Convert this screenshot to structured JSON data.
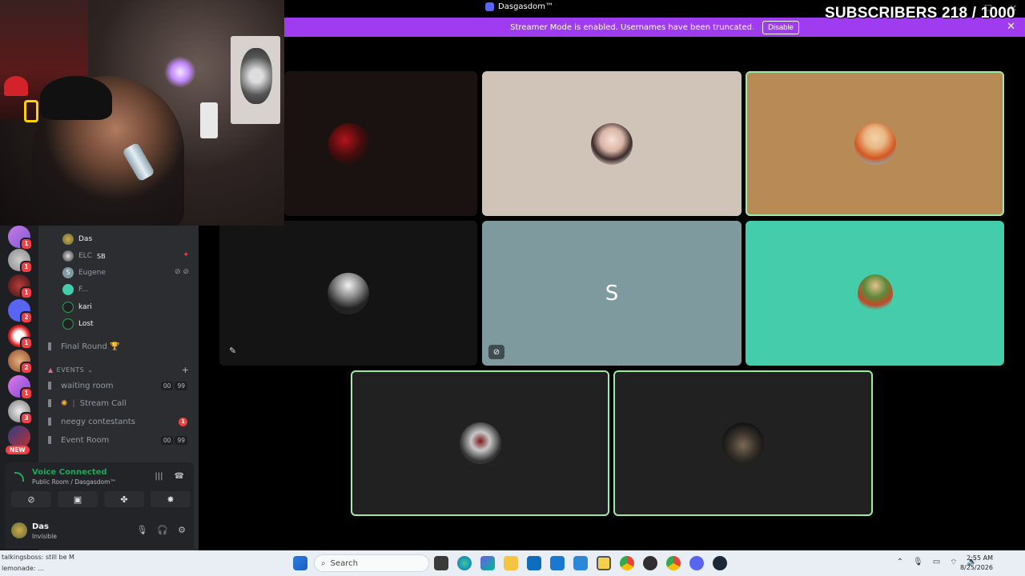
{
  "window": {
    "title": "Dasgasdom™",
    "subscribers_overlay": "SUBSCRIBERS 218 / 1000"
  },
  "banner": {
    "text": "Streamer Mode is enabled. Usernames have been truncated.",
    "button_label": "Disable"
  },
  "servers": {
    "badges": [
      "1",
      "1",
      "1",
      "2",
      "1",
      "2",
      "1",
      "3"
    ],
    "new_label": "NEW"
  },
  "members": [
    {
      "name": "Das"
    },
    {
      "name": "ELC",
      "tag": "SB"
    },
    {
      "name": "Eugene",
      "initial": "S"
    },
    {
      "name": "F..."
    },
    {
      "name": "kari"
    },
    {
      "name": "Lost"
    }
  ],
  "channels": {
    "final_round": "Final Round 🏆",
    "category": "EVENTS",
    "waiting_room": {
      "name": "waiting room",
      "count_a": "00",
      "count_b": "99"
    },
    "stream_call": "Stream Call",
    "neegy": {
      "name": "neegy contestants",
      "badge": "1"
    },
    "event_room": {
      "name": "Event Room",
      "count_a": "00",
      "count_b": "99"
    }
  },
  "voice": {
    "status": "Voice Connected",
    "location": "Public Room / Dasgasdom™"
  },
  "user": {
    "name": "Das",
    "status": "Invisible"
  },
  "tiles": {
    "s_letter": "S"
  },
  "taskbar": {
    "search_placeholder": "Search",
    "time": "2:55 AM",
    "date": "8/25/2026",
    "left_line1": "talkingsboss: still be M",
    "left_line2": "lemonade: ..."
  },
  "colors": {
    "banner": "#a03cf0",
    "voice_green": "#23a55a",
    "speaking_outline": "#9eea9e",
    "badge_red": "#f23f43"
  }
}
